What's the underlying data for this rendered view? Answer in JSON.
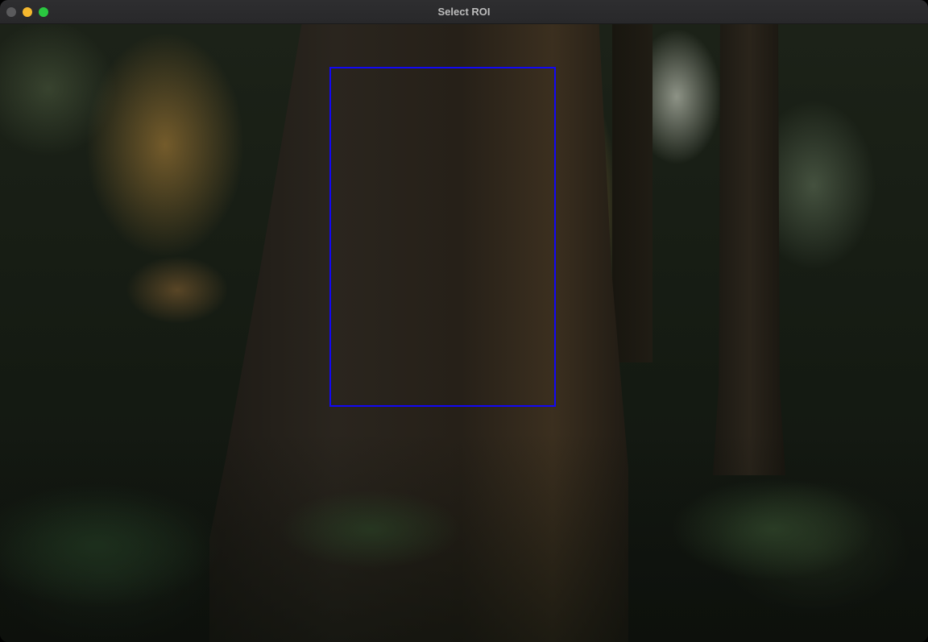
{
  "window": {
    "title": "Select ROI"
  },
  "traffic_lights": {
    "close_color": "#5a5a5c",
    "minimize_color": "#f5b82e",
    "maximize_color": "#2ac840"
  },
  "image": {
    "description_icon": "forest-photo"
  },
  "roi": {
    "border_color": "#1208f5"
  }
}
